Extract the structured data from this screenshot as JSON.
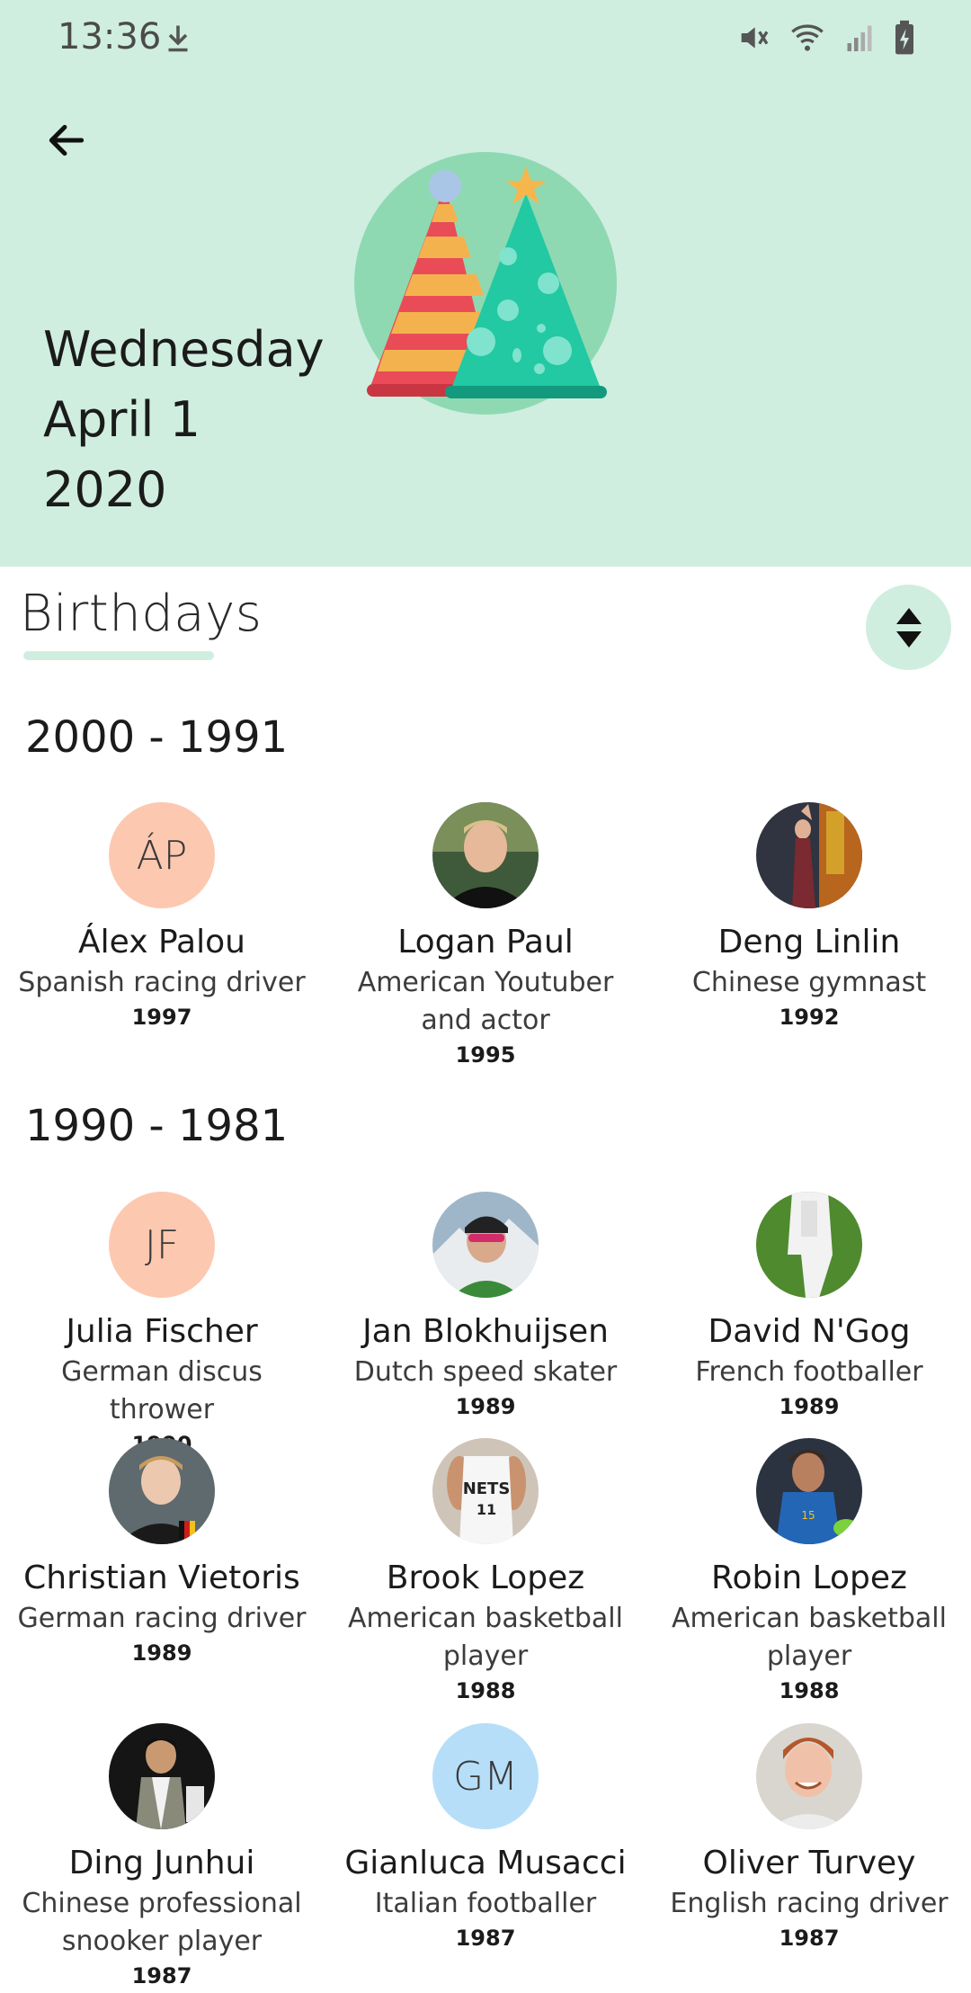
{
  "status_bar": {
    "time": "13:36"
  },
  "header": {
    "weekday": "Wednesday",
    "month_day": "April 1",
    "year": "2020"
  },
  "section": {
    "title": "Birthdays"
  },
  "colors": {
    "header_bg": "#cfeee0",
    "peach": "#fdc8b0",
    "light_blue": "#b6def9"
  },
  "groups": [
    {
      "range": "2000 - 1991",
      "people": [
        {
          "name": "Álex Palou",
          "desc": "Spanish racing driver",
          "year": "1997",
          "initials": "ÁP"
        },
        {
          "name": "Logan Paul",
          "desc": "American Youtuber and actor",
          "year": "1995"
        },
        {
          "name": "Deng Linlin",
          "desc": "Chinese gymnast",
          "year": "1992"
        }
      ]
    },
    {
      "range": "1990 - 1981",
      "people": [
        {
          "name": "Julia Fischer",
          "desc": "German discus thrower",
          "year": "1990",
          "initials": "JF"
        },
        {
          "name": "Jan Blokhuijsen",
          "desc": "Dutch speed skater",
          "year": "1989"
        },
        {
          "name": "David N'Gog",
          "desc": "French footballer",
          "year": "1989"
        },
        {
          "name": "Christian Vietoris",
          "desc": "German racing driver",
          "year": "1989"
        },
        {
          "name": "Brook Lopez",
          "desc": "American basketball player",
          "year": "1988"
        },
        {
          "name": "Robin Lopez",
          "desc": "American basketball player",
          "year": "1988"
        },
        {
          "name": "Ding Junhui",
          "desc": "Chinese professional snooker player",
          "year": "1987"
        },
        {
          "name": "Gianluca Musacci",
          "desc": "Italian footballer",
          "year": "1987",
          "initials": "GM"
        },
        {
          "name": "Oliver Turvey",
          "desc": "English racing driver",
          "year": "1987"
        }
      ]
    }
  ]
}
